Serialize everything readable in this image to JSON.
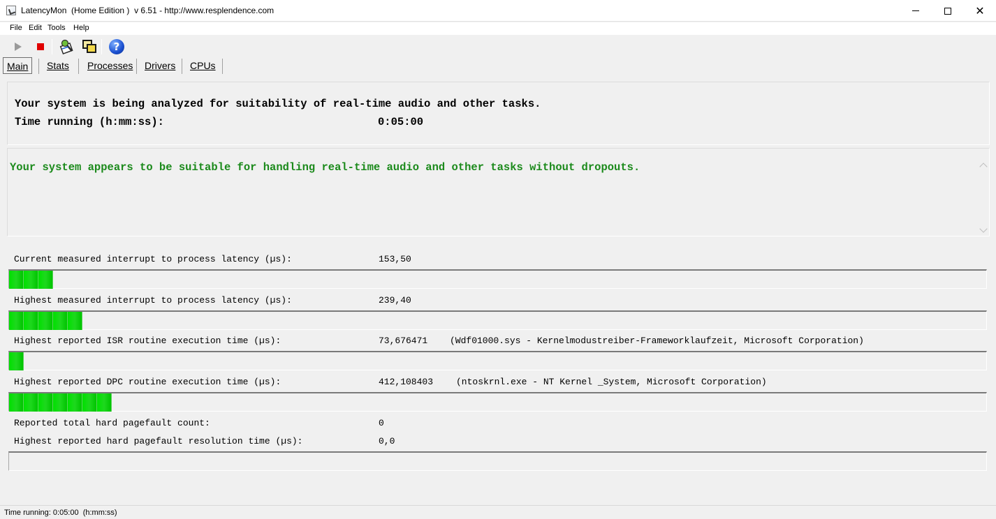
{
  "window": {
    "title": "LatencyMon  (Home Edition )  v 6.51 - http://www.resplendence.com",
    "controls": {
      "minimize": "minimize-icon",
      "maximize": "maximize-icon",
      "close": "close-icon",
      "close_glyph": "✕"
    }
  },
  "menu": {
    "items": [
      "File",
      "Edit",
      "Tools",
      "Help"
    ]
  },
  "toolbar": {
    "icons": [
      "play-icon",
      "stop-icon",
      "report-icon",
      "windows-icon",
      "help-icon"
    ],
    "help_glyph": "?"
  },
  "tabs": [
    "Main",
    "Stats",
    "Processes",
    "Drivers",
    "CPUs"
  ],
  "tabs_active": "Main",
  "summary": {
    "analyzing_text": "Your system is being analyzed for suitability of real-time audio and other tasks.",
    "time_label": "Time running (h:mm:ss):",
    "time_value": "0:05:00"
  },
  "verdict": {
    "text": "Your system appears to be suitable for handling real-time audio and other tasks without dropouts.",
    "color": "#1b8a1b"
  },
  "stats": [
    {
      "label": "Current measured interrupt to process latency (µs):",
      "value": "153,50",
      "extra": "",
      "bar_segments": 3
    },
    {
      "label": "Highest measured interrupt to process latency (µs):",
      "value": "239,40",
      "extra": "",
      "bar_segments": 5
    },
    {
      "label": "Highest reported ISR routine execution time (µs):",
      "value": "73,676471",
      "extra": "(Wdf01000.sys - Kernelmodustreiber-Frameworklaufzeit, Microsoft Corporation)",
      "bar_segments": 1
    },
    {
      "label": "Highest reported DPC routine execution time (µs):",
      "value": "412,108403",
      "extra": "(ntoskrnl.exe - NT Kernel _System, Microsoft Corporation)",
      "bar_segments": 7
    },
    {
      "label": "Reported total hard pagefault count:",
      "value": "0",
      "extra": ""
    },
    {
      "label": "Highest reported hard pagefault resolution time (µs):",
      "value": "0,0",
      "extra": "",
      "bar_segments": 0
    }
  ],
  "statusbar": {
    "text": "Time running: 0:05:00  (h:mm:ss)"
  },
  "colors": {
    "bar_green": "#00e000",
    "stop_red": "#e00000"
  }
}
